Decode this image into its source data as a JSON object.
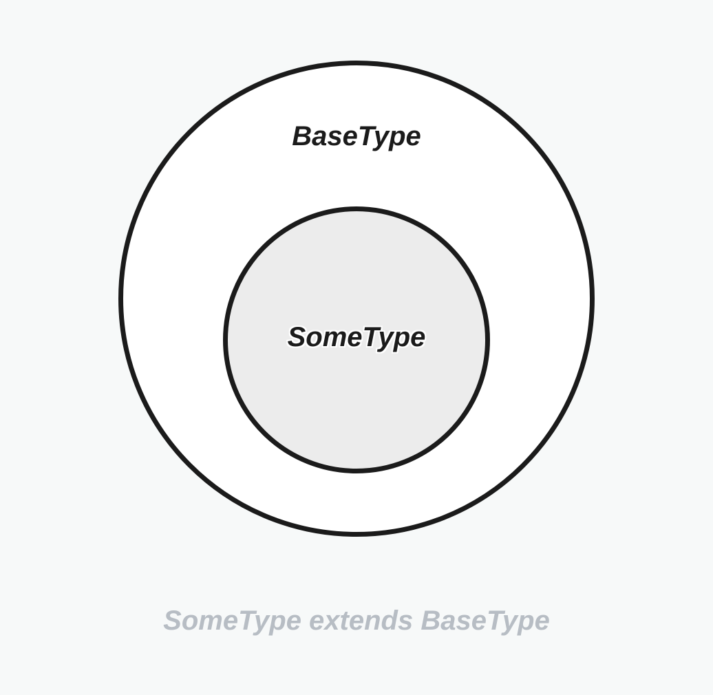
{
  "diagram": {
    "outer_label": "BaseType",
    "inner_label": "SomeType",
    "caption": "SomeType extends BaseType"
  },
  "colors": {
    "background": "#f7f9f9",
    "outer_fill": "#ffffff",
    "inner_fill": "#ececec",
    "stroke": "#1b1b1b",
    "caption": "#b7bdc4"
  }
}
